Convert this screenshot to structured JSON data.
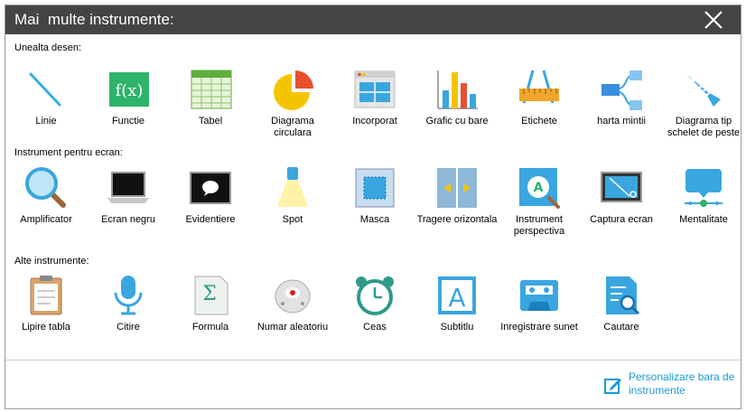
{
  "window": {
    "title": "Mai  multe instrumente:"
  },
  "sections": {
    "drawing": "Unealta desen:",
    "screen": "Instrument pentru ecran:",
    "other": "Alte instrumente:"
  },
  "drawing_tools": [
    {
      "label": "Linie",
      "icon": "line-icon"
    },
    {
      "label": "Functie",
      "icon": "function-icon"
    },
    {
      "label": "Tabel",
      "icon": "table-icon"
    },
    {
      "label": "Diagrama circulara",
      "icon": "pie-chart-icon"
    },
    {
      "label": "Incorporat",
      "icon": "embed-icon"
    },
    {
      "label": "Grafic cu bare",
      "icon": "bar-chart-icon"
    },
    {
      "label": "Etichete",
      "icon": "ruler-label-icon"
    },
    {
      "label": "harta mintii",
      "icon": "mind-map-icon"
    },
    {
      "label": "Diagrama tip schelet de peste",
      "icon": "fishbone-icon"
    }
  ],
  "screen_tools": [
    {
      "label": "Amplificator",
      "icon": "magnifier-icon"
    },
    {
      "label": "Ecran negru",
      "icon": "laptop-icon"
    },
    {
      "label": "Evidentiere",
      "icon": "highlight-icon"
    },
    {
      "label": "Spot",
      "icon": "spotlight-icon"
    },
    {
      "label": "Masca",
      "icon": "mask-icon"
    },
    {
      "label": "Tragere orizontala",
      "icon": "curtain-icon"
    },
    {
      "label": "Instrument perspectiva",
      "icon": "perspective-icon"
    },
    {
      "label": "Captura ecran",
      "icon": "screenshot-icon"
    },
    {
      "label": "Mentalitate",
      "icon": "mentality-icon"
    }
  ],
  "other_tools": [
    {
      "label": "Lipire tabla",
      "icon": "clipboard-icon"
    },
    {
      "label": "Citire",
      "icon": "microphone-icon"
    },
    {
      "label": "Formula",
      "icon": "formula-icon"
    },
    {
      "label": "Numar aleatoriu",
      "icon": "dice-icon"
    },
    {
      "label": "Ceas",
      "icon": "alarm-clock-icon"
    },
    {
      "label": "Subtitlu",
      "icon": "subtitle-icon"
    },
    {
      "label": "Inregistrare sunet",
      "icon": "cassette-icon"
    },
    {
      "label": "Cautare",
      "icon": "search-doc-icon"
    }
  ],
  "footer": {
    "customize_label": "Personalizare bara de instrumente"
  },
  "colors": {
    "titlebar": "#444444",
    "link": "#1a9bd7"
  }
}
